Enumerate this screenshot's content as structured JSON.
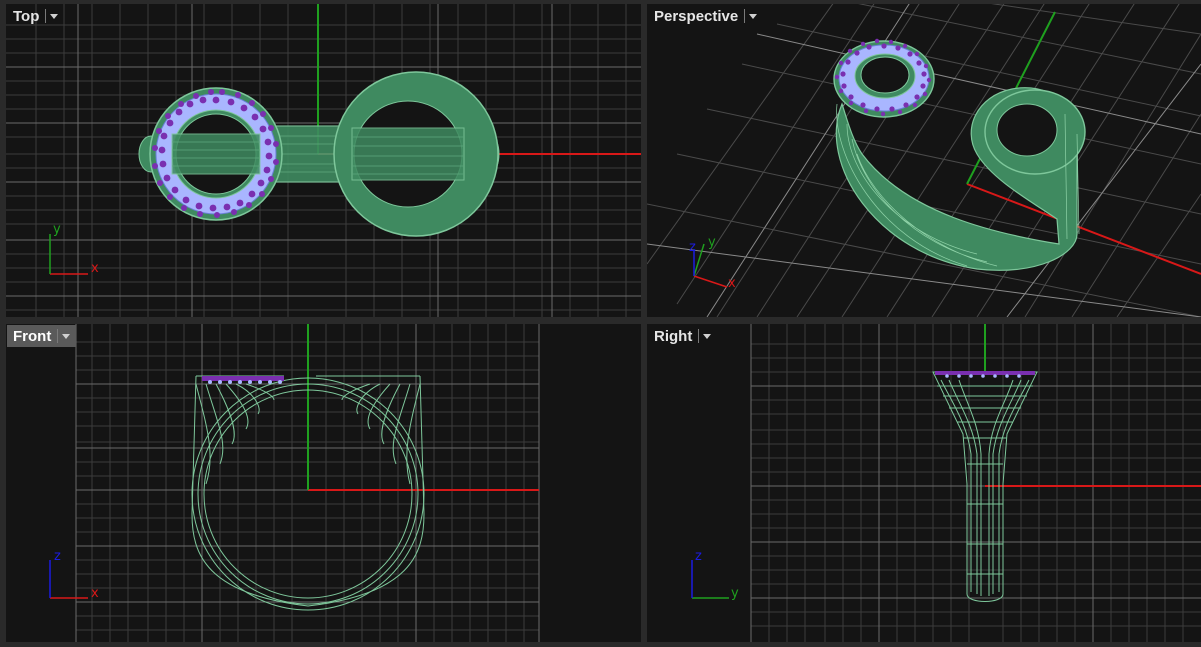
{
  "viewports": {
    "top": {
      "name": "Top",
      "axis_h": "x",
      "axis_v": "y"
    },
    "perspective": {
      "name": "Perspective",
      "axis_h": "x",
      "axis_v": "y",
      "axis_z": "z"
    },
    "front": {
      "name": "Front",
      "axis_h": "x",
      "axis_v": "z"
    },
    "right": {
      "name": "Right",
      "axis_h": "y",
      "axis_v": "z"
    }
  },
  "active_viewport": "Front",
  "colors": {
    "background": "#141414",
    "grid_minor": "#3c3c3c",
    "grid_major": "#6a6a6a",
    "axis_x": "#d81818",
    "axis_y": "#1fa01f",
    "axis_z": "#1b1be0",
    "model_fill": "#3f8a60",
    "model_line": "#7ec79b",
    "gem_setting": "#a9b6ff",
    "gems": "#7a2fb0"
  },
  "icons": [
    "dropdown-caret-icon",
    "axis-gizmo-icon"
  ]
}
